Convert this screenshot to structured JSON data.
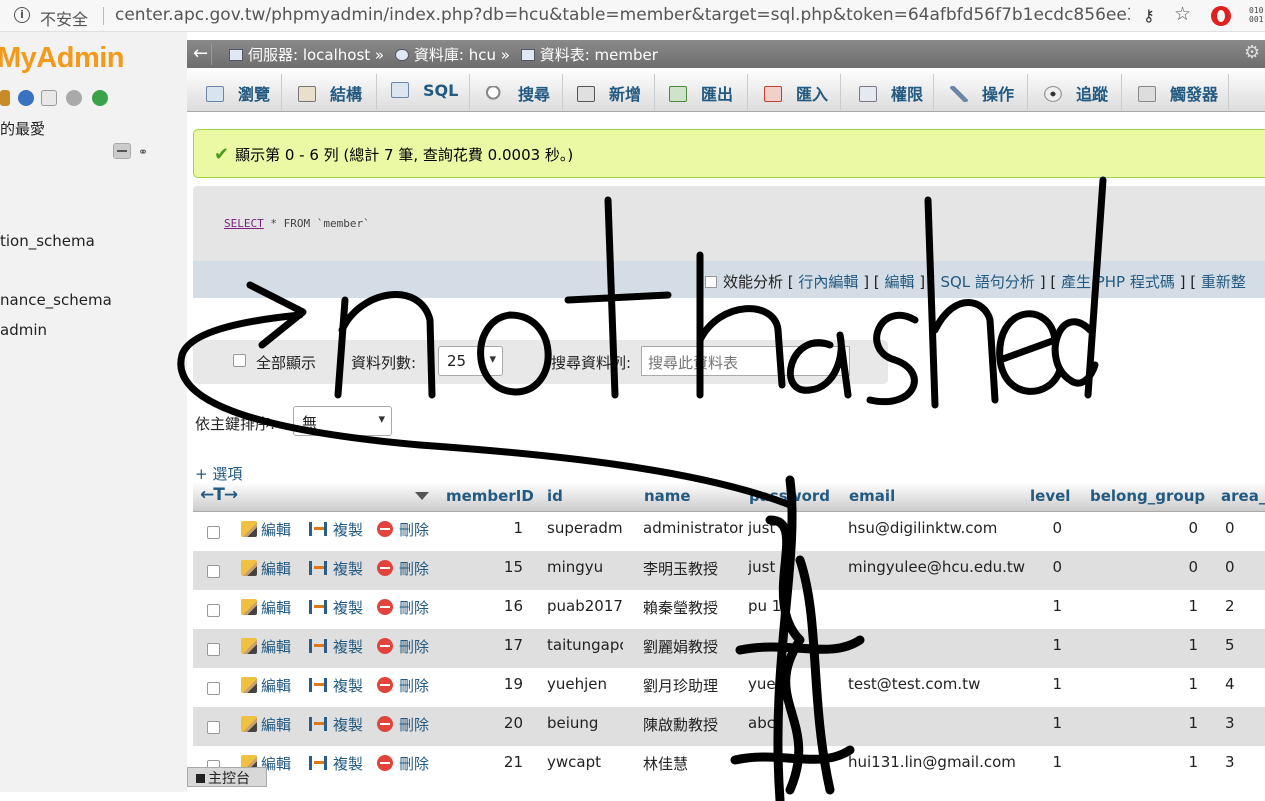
{
  "browser": {
    "insecure_label": "不安全",
    "url": "center.apc.gov.tw/phpmyadmin/index.php?db=hcu&table=member&target=sql.php&token=64afbfd56f7b1ecdc856ee3..."
  },
  "leftnav": {
    "logo": "MyAdmin",
    "favorites": "的最愛",
    "databases": [
      "tion_schema",
      "nance_schema",
      "admin"
    ]
  },
  "console": "主控台",
  "breadcrumb": {
    "server_label": "伺服器: localhost »",
    "db_label": "資料庫: hcu »",
    "table_label": "資料表: member"
  },
  "tabs": [
    "瀏覽",
    "結構",
    "SQL",
    "搜尋",
    "新增",
    "匯出",
    "匯入",
    "權限",
    "操作",
    "追蹤",
    "觸發器"
  ],
  "success_message": "顯示第 0 - 6 列 (總計 7 筆, 查詢花費 0.0003 秒。)",
  "sql": {
    "keyword": "SELECT",
    "rest": " * FROM `member`",
    "profiling_label": "效能分析",
    "inline_edit": "行內編輯",
    "edit": "編輯",
    "explain": "SQL 語句分析",
    "php_code": "產生 PHP 程式碼",
    "refresh": "重新整"
  },
  "nav": {
    "show_all": "全部顯示",
    "rows_label": "資料列數:",
    "rows_value": "25",
    "filter_label": "搜尋資料列:",
    "filter_placeholder": "搜尋此資料表"
  },
  "sort": {
    "label": "依主鍵排序:",
    "value": "無"
  },
  "options_link": "+ 選項",
  "columns": [
    "memberID",
    "id",
    "name",
    "password",
    "email",
    "level",
    "belong_group",
    "area_"
  ],
  "actions": {
    "edit": "編輯",
    "copy": "複製",
    "delete": "刪除"
  },
  "rows": [
    {
      "memberID": "1",
      "id": "superadm",
      "name": "administrator",
      "password": "just",
      "email": "hsu@digilinktw.com",
      "level": "0",
      "belong_group": "0",
      "area": "0"
    },
    {
      "memberID": "15",
      "id": "mingyu",
      "name": "李明玉教授",
      "password": "just",
      "email": "mingyulee@hcu.edu.tw",
      "level": "0",
      "belong_group": "0",
      "area": "0"
    },
    {
      "memberID": "16",
      "id": "puab2017",
      "name": "賴秦瑩教授",
      "password": "pu  17",
      "email": "",
      "level": "1",
      "belong_group": "1",
      "area": "2"
    },
    {
      "memberID": "17",
      "id": "taitungapc",
      "name": "劉麗娟教授",
      "password": "",
      "email": "",
      "level": "1",
      "belong_group": "1",
      "area": "5"
    },
    {
      "memberID": "19",
      "id": "yuehjen",
      "name": "劉月珍助理",
      "password": "yue",
      "email": "test@test.com.tw",
      "level": "1",
      "belong_group": "1",
      "area": "4"
    },
    {
      "memberID": "20",
      "id": "beiung",
      "name": "陳啟勳教授",
      "password": "abc",
      "email": "",
      "level": "1",
      "belong_group": "1",
      "area": "3"
    },
    {
      "memberID": "21",
      "id": "ywcapt",
      "name": "林佳慧",
      "password": "",
      "email": "hui131.lin@gmail.com",
      "level": "1",
      "belong_group": "1",
      "area": "3"
    }
  ],
  "annotation": "not hashed",
  "colors": {
    "link": "#235a81",
    "success_bg": "#ebf8a4",
    "logo": "#f39a1b",
    "delete": "#e0443c"
  }
}
